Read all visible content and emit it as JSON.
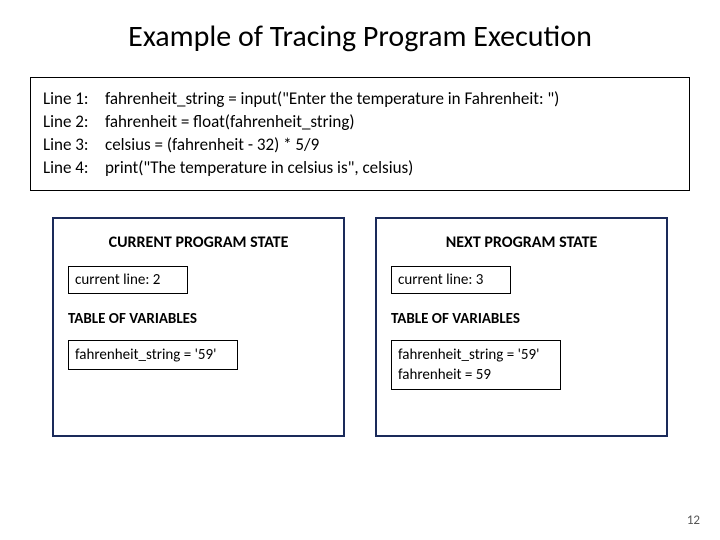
{
  "title": "Example of Tracing Program Execution",
  "code": {
    "lines": [
      {
        "label": "Line 1:",
        "text": "fahrenheit_string = input(\"Enter the temperature in Fahrenheit: \")"
      },
      {
        "label": "Line 2:",
        "text": "fahrenheit = float(fahrenheit_string)"
      },
      {
        "label": "Line 3:",
        "text": "celsius = (fahrenheit - 32) * 5/9"
      },
      {
        "label": "Line 4:",
        "text": "print(\"The temperature in celsius is\", celsius)"
      }
    ]
  },
  "current_state": {
    "heading": "CURRENT PROGRAM STATE",
    "current_line": "current line: 2",
    "table_heading": "TABLE OF VARIABLES",
    "vars": [
      "fahrenheit_string = '59'"
    ]
  },
  "next_state": {
    "heading": "NEXT PROGRAM STATE",
    "current_line": "current line: 3",
    "table_heading": "TABLE OF VARIABLES",
    "vars": [
      "fahrenheit_string = '59'",
      "fahrenheit = 59"
    ]
  },
  "page_number": "12"
}
